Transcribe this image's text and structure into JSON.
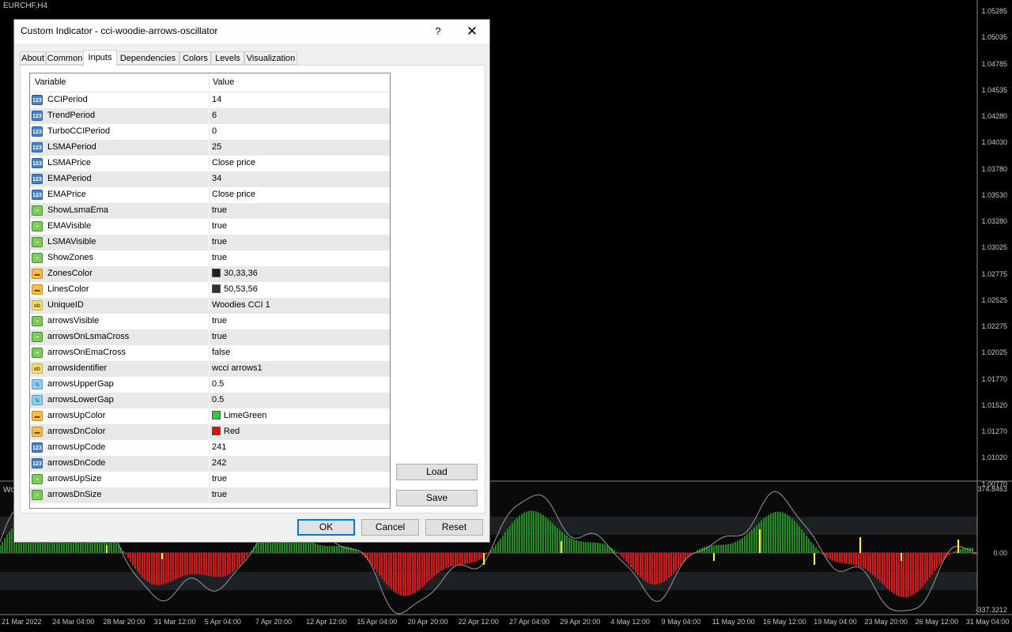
{
  "chart": {
    "symbol": "EURCHF,H4",
    "price_labels": [
      "1.05285",
      "1.05035",
      "1.04785",
      "1.04535",
      "1.04280",
      "1.04030",
      "1.03780",
      "1.03530",
      "1.03280",
      "1.03025",
      "1.02775",
      "1.02525",
      "1.02275",
      "1.02025",
      "1.01770",
      "1.01520",
      "1.01270",
      "1.01020",
      "1.00770"
    ],
    "osc_labels": [
      "374.8463",
      "0.00",
      "-337.3212"
    ],
    "date_labels": [
      "21 Mar 2022",
      "24 Mar 04:00",
      "28 Mar 20:00",
      "31 Mar 12:00",
      "5 Apr 04:00",
      "7 Apr 20:00",
      "12 Apr 12:00",
      "15 Apr 04:00",
      "20 Apr 20:00",
      "22 Apr 12:00",
      "27 Apr 04:00",
      "29 Apr 20:00",
      "4 May 12:00",
      "9 May 04:00",
      "11 May 20:00",
      "16 May 12:00",
      "19 May 04:00",
      "23 May 20:00",
      "26 May 12:00",
      "31 May 04:00"
    ],
    "osc_label_prefix": "Wo"
  },
  "dialog": {
    "title": "Custom Indicator - cci-woodie-arrows-oscillator",
    "help_label": "?",
    "close_label": "✕",
    "tabs": [
      {
        "label": "About",
        "active": false
      },
      {
        "label": "Common",
        "active": false
      },
      {
        "label": "Inputs",
        "active": true
      },
      {
        "label": "Dependencies",
        "active": false
      },
      {
        "label": "Colors",
        "active": false
      },
      {
        "label": "Levels",
        "active": false
      },
      {
        "label": "Visualization",
        "active": false
      }
    ],
    "columns": {
      "variable": "Variable",
      "value": "Value"
    },
    "rows": [
      {
        "type": "int",
        "badge": "123",
        "name": "CCIPeriod",
        "value": "14"
      },
      {
        "type": "int",
        "badge": "123",
        "name": "TrendPeriod",
        "value": "6"
      },
      {
        "type": "int",
        "badge": "123",
        "name": "TurboCCIPeriod",
        "value": "0"
      },
      {
        "type": "int",
        "badge": "123",
        "name": "LSMAPeriod",
        "value": "25"
      },
      {
        "type": "int",
        "badge": "123",
        "name": "LSMAPrice",
        "value": "Close price"
      },
      {
        "type": "int",
        "badge": "123",
        "name": "EMAPeriod",
        "value": "34"
      },
      {
        "type": "int",
        "badge": "123",
        "name": "EMAPrice",
        "value": "Close price"
      },
      {
        "type": "bool",
        "badge": "~",
        "name": "ShowLsmaEma",
        "value": "true"
      },
      {
        "type": "bool",
        "badge": "~",
        "name": "EMAVisible",
        "value": "true"
      },
      {
        "type": "bool",
        "badge": "~",
        "name": "LSMAVisible",
        "value": "true"
      },
      {
        "type": "bool",
        "badge": "~",
        "name": "ShowZones",
        "value": "true"
      },
      {
        "type": "color",
        "badge": "▬",
        "name": "ZonesColor",
        "value": "30,33,36",
        "swatch": "#1e2124"
      },
      {
        "type": "color",
        "badge": "▬",
        "name": "LinesColor",
        "value": "50,53,56",
        "swatch": "#323538"
      },
      {
        "type": "str",
        "badge": "ab",
        "name": "UniqueID",
        "value": "Woodies CCI 1"
      },
      {
        "type": "bool",
        "badge": "~",
        "name": "arrowsVisible",
        "value": "true"
      },
      {
        "type": "bool",
        "badge": "~",
        "name": "arrowsOnLsmaCross",
        "value": "true"
      },
      {
        "type": "bool",
        "badge": "~",
        "name": "arrowsOnEmaCross",
        "value": "false"
      },
      {
        "type": "str",
        "badge": "ab",
        "name": "arrowsIdentifier",
        "value": "wcci arrows1"
      },
      {
        "type": "dbl",
        "badge": "½",
        "name": "arrowsUpperGap",
        "value": "0.5"
      },
      {
        "type": "dbl",
        "badge": "½",
        "name": "arrowsLowerGap",
        "value": "0.5"
      },
      {
        "type": "color",
        "badge": "▬",
        "name": "arrowsUpColor",
        "value": "LimeGreen",
        "swatch": "#32cd32"
      },
      {
        "type": "color",
        "badge": "▬",
        "name": "arrowsDnColor",
        "value": "Red",
        "swatch": "#ff0000"
      },
      {
        "type": "int",
        "badge": "123",
        "name": "arrowsUpCode",
        "value": "241"
      },
      {
        "type": "int",
        "badge": "123",
        "name": "arrowsDnCode",
        "value": "242"
      },
      {
        "type": "bool",
        "badge": "~",
        "name": "arrowsUpSize",
        "value": "true"
      },
      {
        "type": "bool",
        "badge": "~",
        "name": "arrowsDnSize",
        "value": "true"
      }
    ],
    "load_label": "Load",
    "save_label": "Save",
    "ok_label": "OK",
    "cancel_label": "Cancel",
    "reset_label": "Reset"
  },
  "colors": {
    "up_arrow": "#32cd32",
    "down_arrow": "#ff0000",
    "osc_up": "#1e8c1e",
    "osc_down": "#e01414",
    "zone": "#1e2124"
  }
}
